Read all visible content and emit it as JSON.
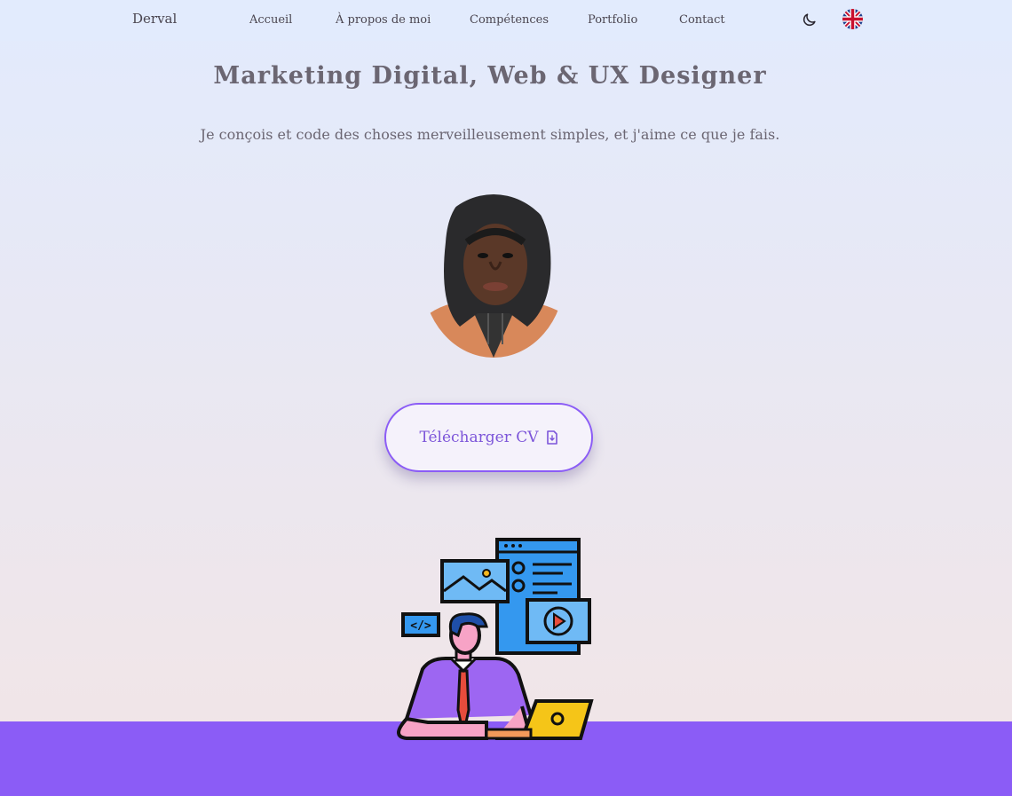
{
  "nav": {
    "brand": "Derval",
    "links": [
      {
        "label": "Accueil"
      },
      {
        "label": "À propos de moi"
      },
      {
        "label": "Compétences"
      },
      {
        "label": "Portfolio"
      },
      {
        "label": "Contact"
      }
    ],
    "theme_toggle_icon": "moon-icon",
    "language_icon": "uk-flag-icon"
  },
  "hero": {
    "title": "Marketing Digital, Web & UX Designer",
    "subtitle": "Je conçois et code des choses merveilleusement simples, et j'aime ce que je fais.",
    "cv_button": "Télécharger CV",
    "cv_button_icon": "file-download-icon"
  },
  "colors": {
    "accent": "#8b5cf6",
    "text": "#6b6672",
    "background_top": "#e2ebfd",
    "background_bottom": "#f2e4e6"
  }
}
